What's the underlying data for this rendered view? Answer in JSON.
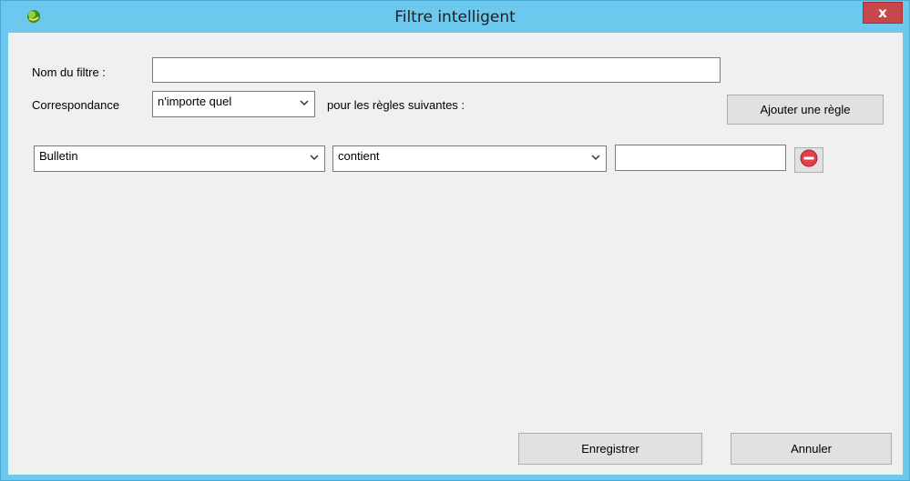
{
  "window": {
    "title": "Filtre intelligent",
    "close_label": "x"
  },
  "filter_name": {
    "label": "Nom du filtre :",
    "value": ""
  },
  "match": {
    "label": "Correspondance",
    "selected": "n'importe quel",
    "suffix": "pour les règles suivantes :"
  },
  "add_rule_label": "Ajouter une règle",
  "rule": {
    "field": "Bulletin",
    "operator": "contient",
    "value": ""
  },
  "save_label": "Enregistrer",
  "cancel_label": "Annuler",
  "colors": {
    "title_bar": "#6cc8ec",
    "close_button": "#c8474b",
    "remove_icon": "#e0414a"
  }
}
